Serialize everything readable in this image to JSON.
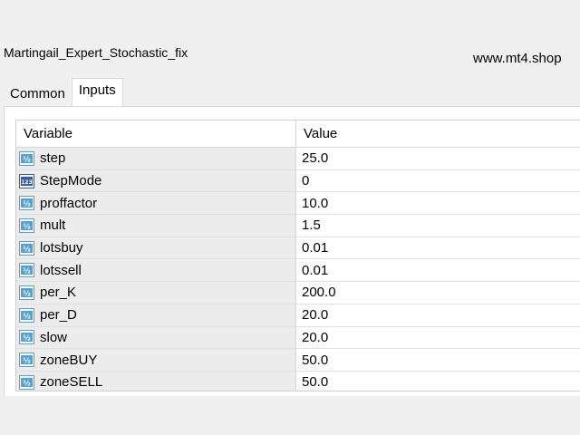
{
  "window": {
    "title": "Martingail_Expert_Stochastic_fix"
  },
  "watermark": "www.mt4.shop",
  "tabs": [
    {
      "label": "Common",
      "active": false
    },
    {
      "label": "Inputs",
      "active": true
    }
  ],
  "grid": {
    "columns": {
      "variable": "Variable",
      "value": "Value"
    },
    "rows": [
      {
        "name": "step",
        "value": "25.0",
        "icon": "double-value-icon"
      },
      {
        "name": "StepMode",
        "value": "0",
        "icon": "integer-value-icon"
      },
      {
        "name": "proffactor",
        "value": "10.0",
        "icon": "double-value-icon"
      },
      {
        "name": "mult",
        "value": "1.5",
        "icon": "double-value-icon"
      },
      {
        "name": "lotsbuy",
        "value": "0.01",
        "icon": "double-value-icon"
      },
      {
        "name": "lotssell",
        "value": "0.01",
        "icon": "double-value-icon"
      },
      {
        "name": "per_K",
        "value": "200.0",
        "icon": "double-value-icon"
      },
      {
        "name": "per_D",
        "value": "20.0",
        "icon": "double-value-icon"
      },
      {
        "name": "slow",
        "value": "20.0",
        "icon": "double-value-icon"
      },
      {
        "name": "zoneBUY",
        "value": "50.0",
        "icon": "double-value-icon"
      },
      {
        "name": "zoneSELL",
        "value": "50.0",
        "icon": "double-value-icon"
      }
    ]
  },
  "icon_labels": {
    "double": "½",
    "integer": "123"
  },
  "colors": {
    "double_icon": "#4fa3d9",
    "integer_icon": "#2f5fa8",
    "variable_cell_bg": "#ececec",
    "grid_border": "#d0d0d0"
  }
}
